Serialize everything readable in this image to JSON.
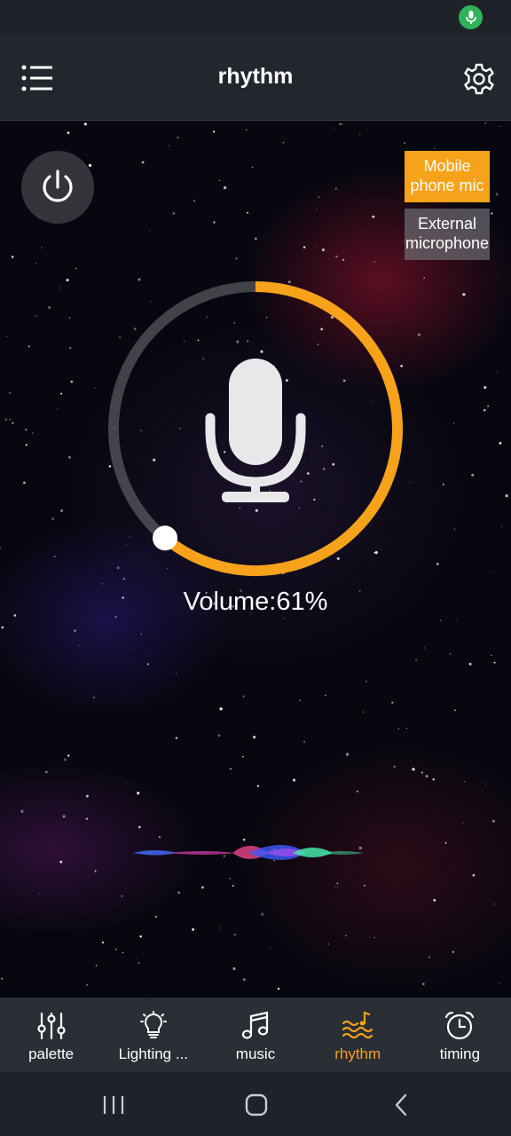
{
  "app": {
    "title": "rhythm"
  },
  "sources": {
    "mobile_label": "Mobile phone mic",
    "external_label": "External microphone",
    "selected": "Mobile phone mic"
  },
  "volume": {
    "label": "Volume:61%",
    "percent": 61
  },
  "tabs": [
    {
      "label": "palette",
      "icon": "sliders-icon",
      "active": false
    },
    {
      "label": "Lighting ...",
      "icon": "lightbulb-icon",
      "active": false
    },
    {
      "label": "music",
      "icon": "music-note-icon",
      "active": false
    },
    {
      "label": "rhythm",
      "icon": "rhythm-wave-icon",
      "active": true
    },
    {
      "label": "timing",
      "icon": "alarm-clock-icon",
      "active": false
    }
  ],
  "colors": {
    "accent": "#f7a21b",
    "status_mic": "#2fb35a",
    "bar_bg": "#2a2e35"
  }
}
